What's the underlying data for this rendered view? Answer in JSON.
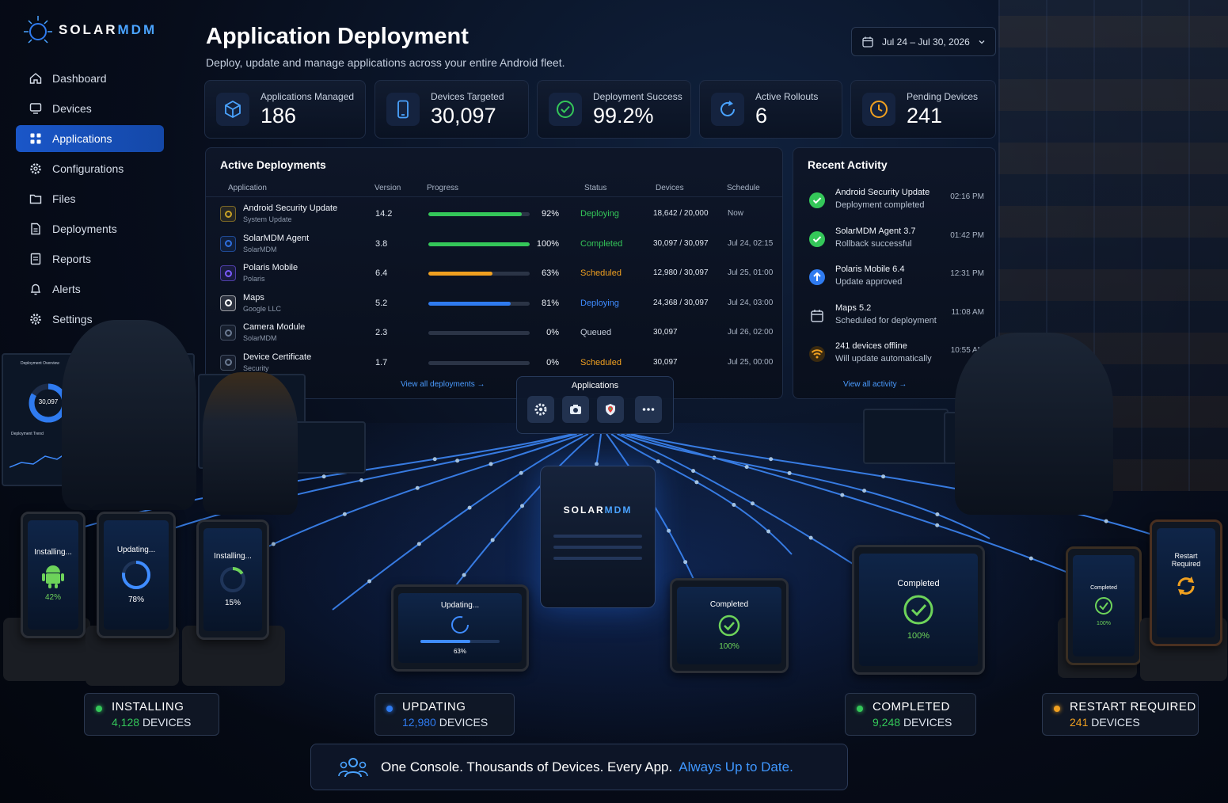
{
  "brand": {
    "prefix": "SOLAR",
    "suffix": "MDM"
  },
  "sidebar": {
    "items": [
      {
        "label": "Dashboard",
        "icon": "home-icon"
      },
      {
        "label": "Devices",
        "icon": "monitor-icon"
      },
      {
        "label": "Applications",
        "icon": "grid-icon",
        "active": true
      },
      {
        "label": "Configurations",
        "icon": "cog-icon"
      },
      {
        "label": "Files",
        "icon": "folder-icon"
      },
      {
        "label": "Deployments",
        "icon": "document-icon"
      },
      {
        "label": "Reports",
        "icon": "report-icon"
      },
      {
        "label": "Alerts",
        "icon": "bell-icon"
      },
      {
        "label": "Settings",
        "icon": "gear-icon"
      }
    ]
  },
  "header": {
    "title": "Application Deployment",
    "subtitle": "Deploy, update and manage applications across your entire Android fleet.",
    "date_range": "Jul 24 – Jul 30, 2026"
  },
  "stats": [
    {
      "label": "Applications Managed",
      "value": "186",
      "icon": "cube-icon",
      "color": "#4aa3ff"
    },
    {
      "label": "Devices Targeted",
      "value": "30,097",
      "icon": "phone-icon",
      "color": "#4aa3ff"
    },
    {
      "label": "Deployment Success",
      "value": "99.2%",
      "icon": "check-circle-icon",
      "color": "#34c759"
    },
    {
      "label": "Active Rollouts",
      "value": "6",
      "icon": "refresh-icon",
      "color": "#4aa3ff"
    },
    {
      "label": "Pending Devices",
      "value": "241",
      "icon": "clock-icon",
      "color": "#f0a020"
    }
  ],
  "deployments": {
    "title": "Active Deployments",
    "columns": {
      "application": "Application",
      "version": "Version",
      "progress": "Progress",
      "status": "Status",
      "devices": "Devices",
      "schedule": "Schedule"
    },
    "rows": [
      {
        "name": "Android Security Update",
        "publisher": "System Update",
        "version": "14.2",
        "progress": 0.92,
        "progress_label": "92%",
        "status": "Deploying",
        "status_color": "#34c759",
        "bar_color": "#34c759",
        "devices": "18,642 / 20,000",
        "schedule": "Now",
        "icon_color": "#c9a227"
      },
      {
        "name": "SolarMDM Agent",
        "publisher": "SolarMDM",
        "version": "3.8",
        "progress": 1.0,
        "progress_label": "100%",
        "status": "Completed",
        "status_color": "#34c759",
        "bar_color": "#34c759",
        "devices": "30,097 / 30,097",
        "schedule": "Jul 24, 02:15",
        "icon_color": "#2f6fe0"
      },
      {
        "name": "Polaris Mobile",
        "publisher": "Polaris",
        "version": "6.4",
        "progress": 0.63,
        "progress_label": "63%",
        "status": "Scheduled",
        "status_color": "#f0a020",
        "bar_color": "#f0a020",
        "devices": "12,980 / 30,097",
        "schedule": "Jul 25, 01:00",
        "icon_color": "#7b5cff"
      },
      {
        "name": "Maps",
        "publisher": "Google LLC",
        "version": "5.2",
        "progress": 0.81,
        "progress_label": "81%",
        "status": "Deploying",
        "status_color": "#3f8cff",
        "bar_color": "#2f7bf0",
        "devices": "24,368 / 30,097",
        "schedule": "Jul 24, 03:00",
        "icon_color": "#ffffff"
      },
      {
        "name": "Camera Module",
        "publisher": "SolarMDM",
        "version": "2.3",
        "progress": 0.0,
        "progress_label": "0%",
        "status": "Queued",
        "status_color": "#c3ccda",
        "bar_color": "#3a4458",
        "devices": "30,097",
        "schedule": "Jul 26, 02:00",
        "icon_color": "#6b7a92"
      },
      {
        "name": "Device Certificate",
        "publisher": "Security",
        "version": "1.7",
        "progress": 0.0,
        "progress_label": "0%",
        "status": "Scheduled",
        "status_color": "#f0a020",
        "bar_color": "#3a4458",
        "devices": "30,097",
        "schedule": "Jul 25, 00:00",
        "icon_color": "#6b7a92"
      }
    ],
    "view_all": "View all deployments →"
  },
  "activity": {
    "title": "Recent Activity",
    "items": [
      {
        "title": "Android Security Update",
        "subtitle": "Deployment completed",
        "time": "02:16 PM",
        "icon": "check-circle-icon",
        "color": "#34c759"
      },
      {
        "title": "SolarMDM Agent  3.7",
        "subtitle": "Rollback successful",
        "time": "01:42 PM",
        "icon": "check-circle-icon",
        "color": "#34c759"
      },
      {
        "title": "Polaris Mobile  6.4",
        "subtitle": "Update approved",
        "time": "12:31 PM",
        "icon": "upload-icon",
        "color": "#2f7bf0"
      },
      {
        "title": "Maps  5.2",
        "subtitle": "Scheduled for deployment",
        "time": "11:08 AM",
        "icon": "calendar-icon",
        "color": "#c3ccda"
      },
      {
        "title": "241 devices offline",
        "subtitle": "Will update automatically",
        "time": "10:55 AM",
        "icon": "wifi-icon",
        "color": "#f0a020"
      }
    ],
    "view_all": "View all activity →"
  },
  "apps_toolbar": {
    "title": "Applications"
  },
  "server": {
    "prefix": "SOLAR",
    "suffix": "MDM"
  },
  "monitor_screen": {
    "left_title": "Deployment Overview",
    "center_value": "30,097",
    "bottom_title": "Deployment Trend"
  },
  "devices_scene": {
    "left": [
      {
        "label": "Installing...",
        "value": "42%"
      },
      {
        "label": "Updating...",
        "value": "78%"
      },
      {
        "label": "Installing...",
        "value": "15%"
      }
    ],
    "center_left": {
      "label": "Updating...",
      "value": "63%"
    },
    "center_right": {
      "label": "Completed",
      "value": "100%"
    },
    "right_big": {
      "label": "Completed",
      "value": "100%"
    },
    "right_small": {
      "label": "Completed",
      "value": "100%"
    },
    "right_restart": {
      "label": "Restart Required"
    }
  },
  "status_pills": [
    {
      "title": "INSTALLING",
      "count": "4,128",
      "unit": "DEVICES",
      "color": "#34c759"
    },
    {
      "title": "UPDATING",
      "count": "12,980",
      "unit": "DEVICES",
      "color": "#2f7bf0"
    },
    {
      "title": "COMPLETED",
      "count": "9,248",
      "unit": "DEVICES",
      "color": "#34c759"
    },
    {
      "title": "RESTART REQUIRED",
      "count": "241",
      "unit": "DEVICES",
      "color": "#f0a020"
    }
  ],
  "tagline": {
    "main": "One Console. Thousands of Devices. Every App.",
    "highlight": "Always Up to Date."
  }
}
